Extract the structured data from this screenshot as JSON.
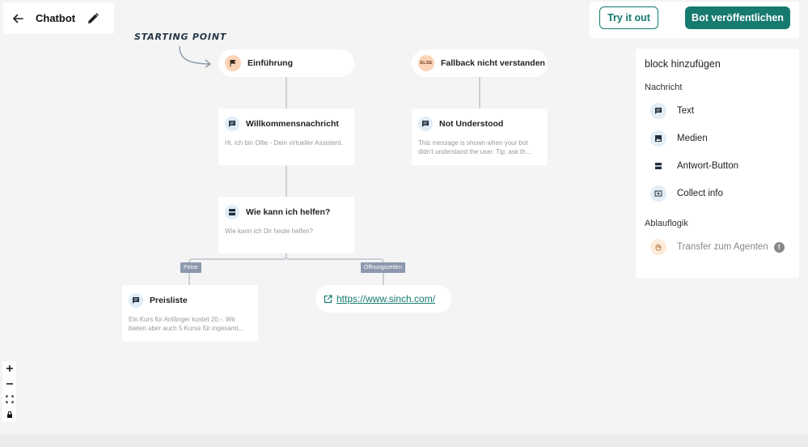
{
  "header": {
    "title": "Chatbot",
    "try_label": "Try it out",
    "publish_label": "Bot veröffentlichen"
  },
  "canvas": {
    "starting_label": "STARTING POINT",
    "start_node": {
      "label": "Einführung",
      "icon": "flag-icon"
    },
    "fallback_node": {
      "label": "Fallback nicht verstanden",
      "badge": "ELSE"
    },
    "nodes": [
      {
        "title": "Willkommensnachricht",
        "text": "Hi, ich bin Ollie - Dein virtueller Assistent.",
        "icon": "message-icon"
      },
      {
        "title": "Not Understood",
        "text": "This message is shown when your bot didn't understand the user. Tip: ask th...",
        "icon": "message-icon"
      },
      {
        "title": "Wie kann ich helfen?",
        "text": "Wie kann ich Dir heute helfen?",
        "icon": "button-icon"
      },
      {
        "title": "Preisliste",
        "text": "Ein Kurs für Anfänger kostet 20,-. Wir bieten aber auch 5 Kurse für ingesamt...",
        "icon": "message-icon"
      }
    ],
    "edge_labels": [
      "Peise",
      "Öffnungszeiten"
    ],
    "link_node": {
      "url": "https://www.sinch.com/",
      "icon": "external-link-icon"
    }
  },
  "zoom_controls": [
    "+",
    "−",
    "fit-view-icon",
    "lock-icon"
  ],
  "panel": {
    "title": "block hinzufügen",
    "sections": [
      {
        "title": "Nachricht",
        "items": [
          {
            "label": "Text",
            "icon": "message-icon"
          },
          {
            "label": "Medien",
            "icon": "image-icon"
          },
          {
            "label": "Antwort-Button",
            "icon": "button-icon"
          },
          {
            "label": "Collect info",
            "icon": "input-icon"
          }
        ]
      },
      {
        "title": "Ablauflogik",
        "items": [
          {
            "label": "Transfer zum Agenten",
            "icon": "hand-icon",
            "info": "!"
          }
        ]
      }
    ]
  },
  "colors": {
    "accent": "#167a6f",
    "badge_orange": "#fbd3b7",
    "icon_blue_bg": "#e0ecf6",
    "edge_label_bg": "#8b98ad",
    "canvas_bg": "#f4f4f4"
  }
}
